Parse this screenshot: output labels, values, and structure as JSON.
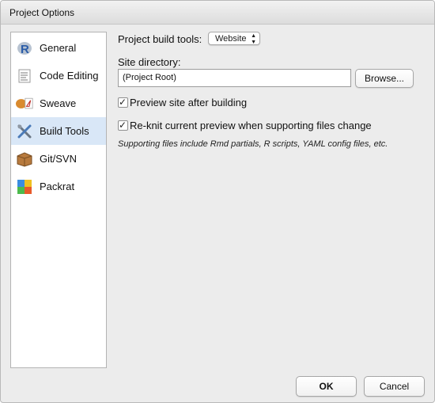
{
  "window": {
    "title": "Project Options"
  },
  "sidebar": {
    "items": [
      {
        "label": "General",
        "icon": "r-logo-icon"
      },
      {
        "label": "Code Editing",
        "icon": "document-icon"
      },
      {
        "label": "Sweave",
        "icon": "sweave-pdf-icon"
      },
      {
        "label": "Build Tools",
        "icon": "tools-icon",
        "selected": true
      },
      {
        "label": "Git/SVN",
        "icon": "package-box-icon"
      },
      {
        "label": "Packrat",
        "icon": "packrat-icon"
      }
    ]
  },
  "main": {
    "build_tools_label": "Project build tools:",
    "build_tools_value": "Website",
    "site_directory_label": "Site directory:",
    "site_directory_value": "(Project Root)",
    "browse_label": "Browse...",
    "preview_label": "Preview site after building",
    "preview_checked": true,
    "reknit_label": "Re-knit current preview when supporting files change",
    "reknit_checked": true,
    "note": "Supporting files include Rmd partials, R scripts, YAML config files, etc."
  },
  "footer": {
    "ok_label": "OK",
    "cancel_label": "Cancel"
  },
  "colors": {
    "selected_bg": "#d9e7f7",
    "dialog_bg": "#ececec"
  }
}
